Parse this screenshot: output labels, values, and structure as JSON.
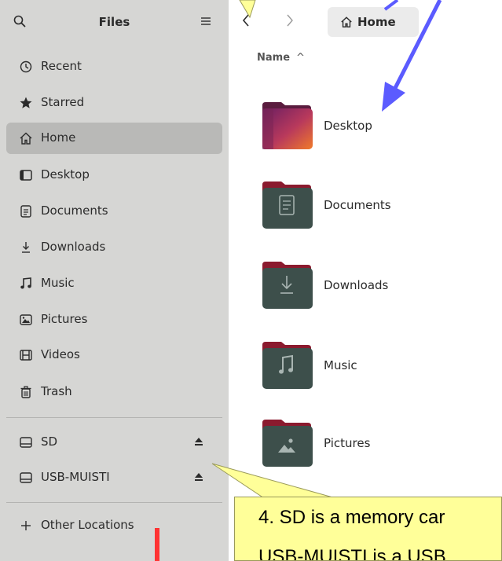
{
  "sidebar": {
    "title": "Files",
    "search_icon": "search-icon",
    "menu_icon": "hamburger-menu-icon",
    "places": [
      {
        "label": "Recent",
        "icon": "clock-icon"
      },
      {
        "label": "Starred",
        "icon": "star-icon"
      },
      {
        "label": "Home",
        "icon": "home-icon",
        "active": true
      },
      {
        "label": "Desktop",
        "icon": "desktop-icon"
      },
      {
        "label": "Documents",
        "icon": "document-icon"
      },
      {
        "label": "Downloads",
        "icon": "download-icon"
      },
      {
        "label": "Music",
        "icon": "music-note-icon"
      },
      {
        "label": "Pictures",
        "icon": "picture-icon"
      },
      {
        "label": "Videos",
        "icon": "film-icon"
      },
      {
        "label": "Trash",
        "icon": "trash-icon"
      }
    ],
    "devices": [
      {
        "label": "SD",
        "icon": "drive-icon",
        "eject_icon": "eject-icon"
      },
      {
        "label": "USB-MUISTI",
        "icon": "drive-icon",
        "eject_icon": "eject-icon"
      }
    ],
    "other_locations": {
      "label": "Other Locations",
      "icon": "plus-icon"
    }
  },
  "toolbar": {
    "back_icon": "chevron-left-icon",
    "forward_icon": "chevron-right-icon",
    "path": {
      "label": "Home",
      "icon": "home-icon"
    }
  },
  "listing": {
    "sort_column": "Name",
    "sort_indicator": "^",
    "items": [
      {
        "name": "Desktop",
        "icon": "desktop-folder-icon"
      },
      {
        "name": "Documents",
        "icon": "documents-folder-icon"
      },
      {
        "name": "Downloads",
        "icon": "downloads-folder-icon"
      },
      {
        "name": "Music",
        "icon": "music-folder-icon"
      },
      {
        "name": "Pictures",
        "icon": "pictures-folder-icon"
      }
    ]
  },
  "annotation": {
    "callout_line1": "4. SD is a memory car",
    "callout_line2": "USB-MUISTI is a USB"
  },
  "colors": {
    "sidebar_bg": "#d6d6d4",
    "active_item": "#b9b9b7",
    "folder_body": "#3d4f4b",
    "folder_tab": "#8b1a2e",
    "arrow_blue": "#5b5bff",
    "callout_yellow": "#ffff99"
  }
}
